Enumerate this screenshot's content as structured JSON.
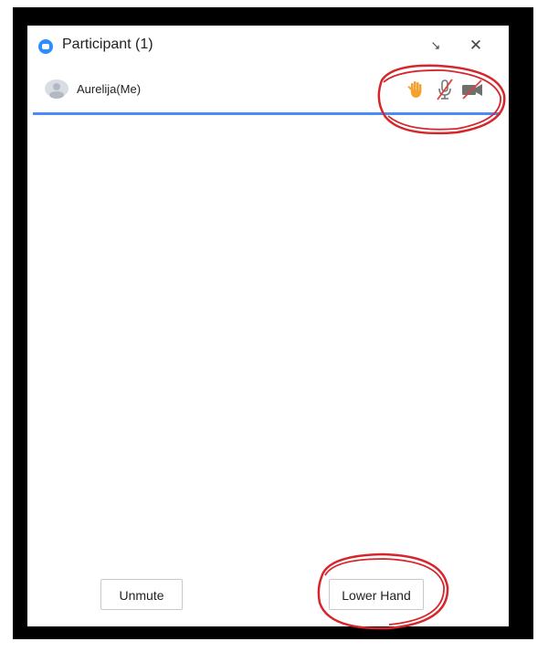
{
  "window": {
    "title": "Participant (1)",
    "minimize_icon": "arrow-down-right-icon",
    "close_icon": "close-icon"
  },
  "participants": [
    {
      "name": "Aurelija(Me)",
      "avatar_icon": "user-avatar-icon",
      "status_icons": [
        "raised-hand-icon",
        "mic-muted-icon",
        "video-off-icon"
      ]
    }
  ],
  "actions": {
    "unmute_label": "Unmute",
    "lower_hand_label": "Lower Hand"
  },
  "colors": {
    "accent_blue": "#4a8cf7",
    "app_icon_blue": "#2d8cff",
    "hand_orange": "#f4a12e",
    "muted_red": "#e0413a",
    "annotation_red": "#d6262b"
  }
}
